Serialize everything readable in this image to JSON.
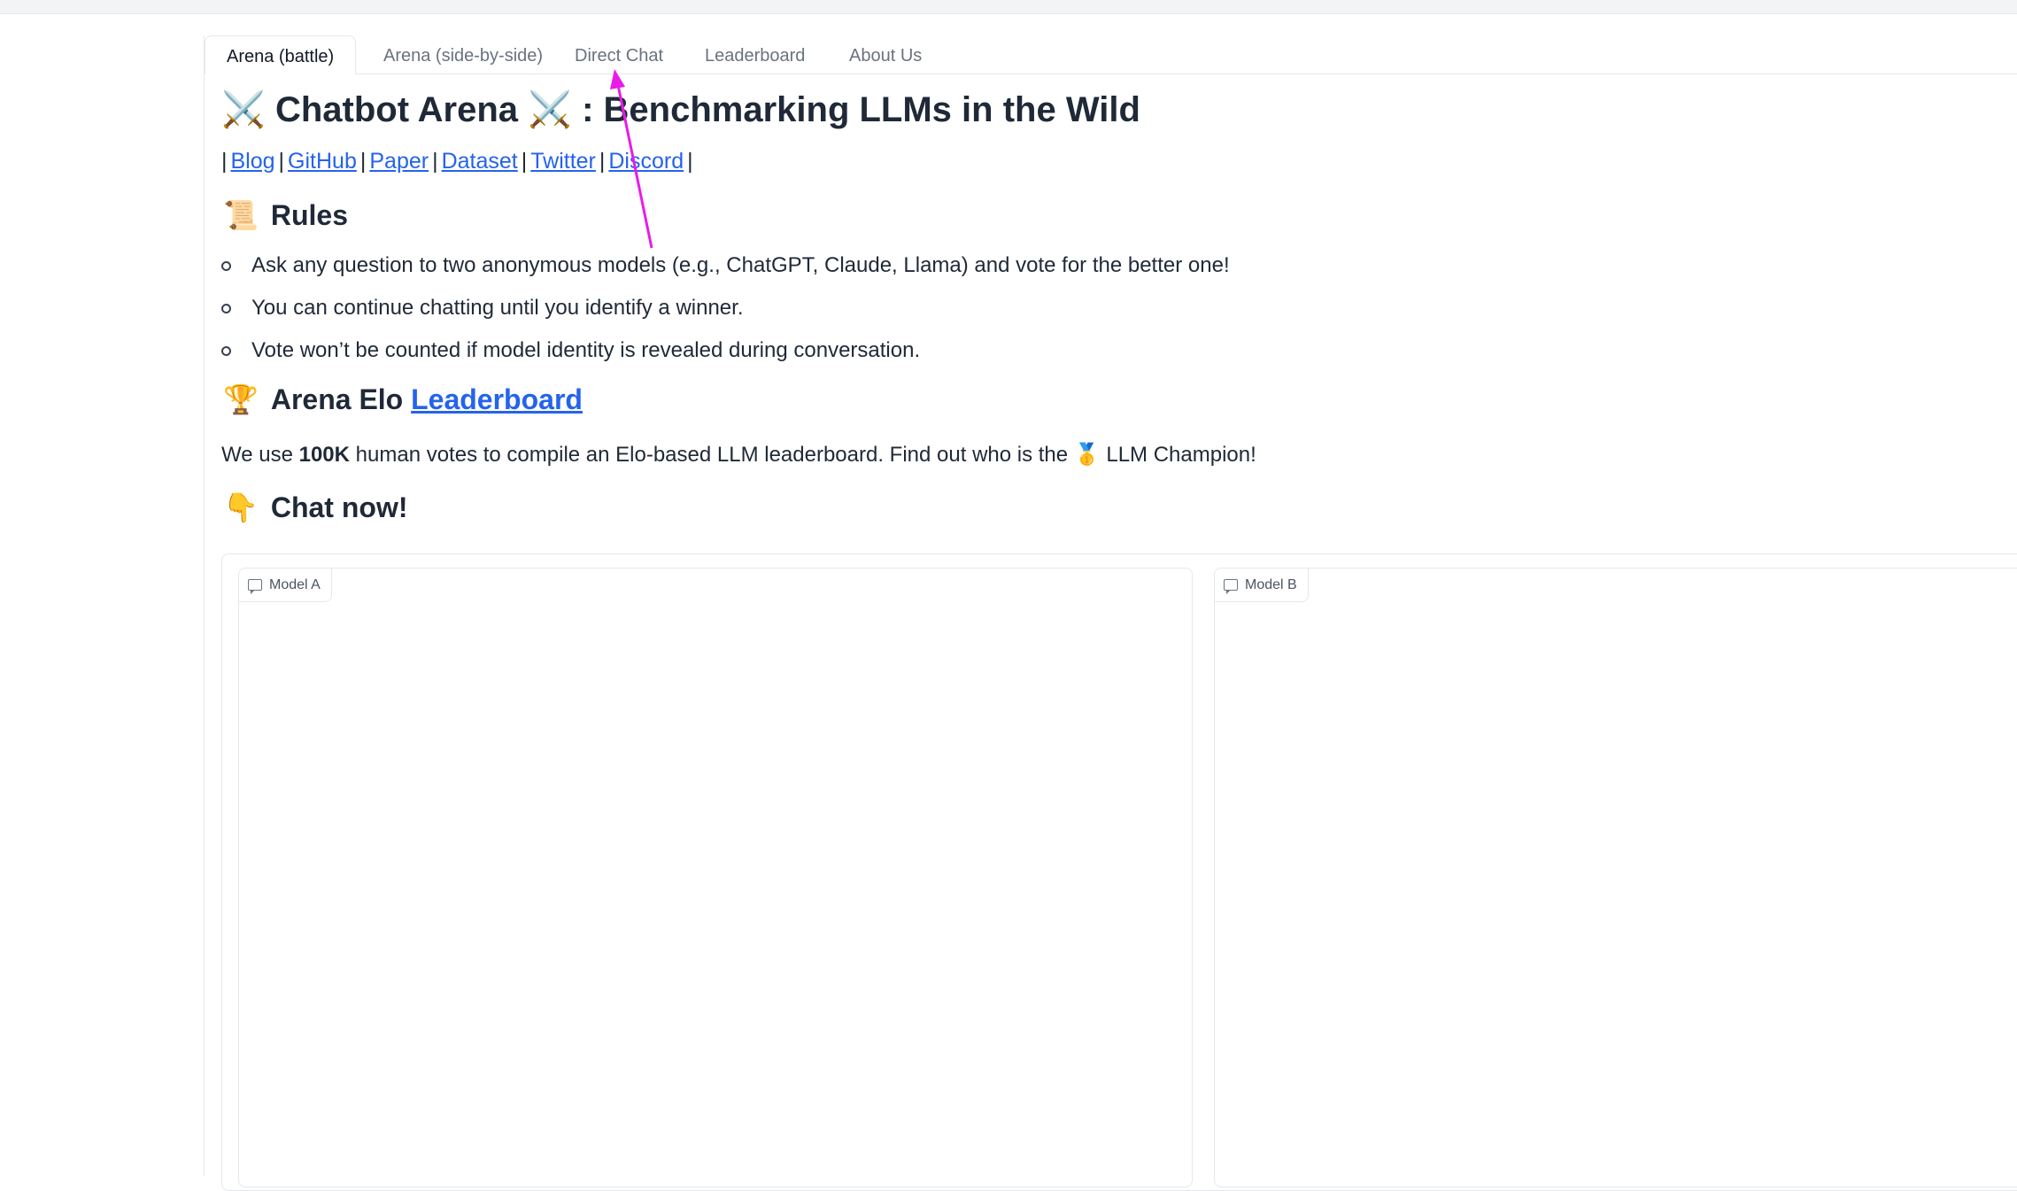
{
  "tabs": [
    {
      "label": "Arena (battle)",
      "active": true
    },
    {
      "label": "Arena (side-by-side)",
      "active": false
    },
    {
      "label": "Direct Chat",
      "active": false
    },
    {
      "label": "Leaderboard",
      "active": false
    },
    {
      "label": "About Us",
      "active": false
    }
  ],
  "header": {
    "title_text": "Chatbot Arena",
    "subtitle_text": ": Benchmarking LLMs in the Wild",
    "title_emoji": "⚔️"
  },
  "links": {
    "separator": "|",
    "items": [
      "Blog",
      "GitHub",
      "Paper",
      "Dataset",
      "Twitter",
      "Discord"
    ]
  },
  "rules": {
    "emoji": "📜",
    "heading": "Rules",
    "items": [
      "Ask any question to two anonymous models (e.g., ChatGPT, Claude, Llama) and vote for the better one!",
      "You can continue chatting until you identify a winner.",
      "Vote won’t be counted if model identity is revealed during conversation."
    ]
  },
  "elo": {
    "emoji": "🏆",
    "heading_prefix": "Arena Elo",
    "heading_link": "Leaderboard",
    "text_before": "We use",
    "text_bold": "100K",
    "text_middle": "human votes to compile an Elo-based LLM leaderboard. Find out who is the",
    "medal_emoji": "🥇",
    "text_after": "LLM Champion!"
  },
  "chat": {
    "emoji": "👇",
    "heading": "Chat now!",
    "model_a_label": "Model A",
    "model_b_label": "Model B"
  },
  "colors": {
    "link": "#2563eb",
    "annotation_arrow": "#e81ce8",
    "border": "#e5e7eb"
  }
}
